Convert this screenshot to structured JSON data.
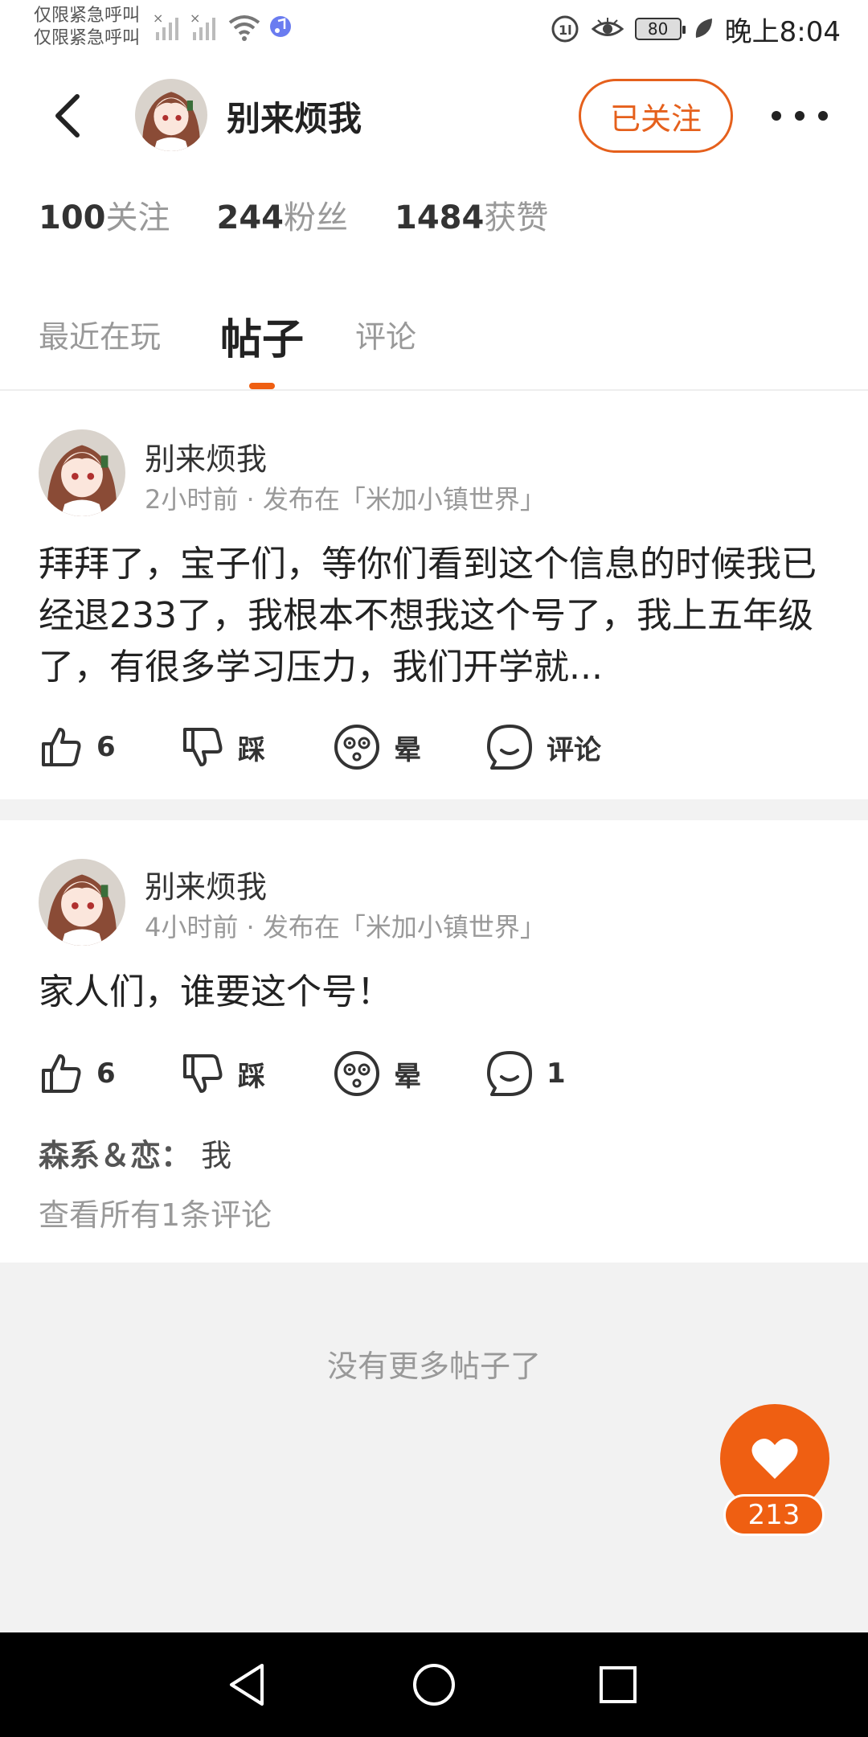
{
  "status_bar": {
    "carrier_line1": "仅限紧急呼叫",
    "carrier_line2": "仅限紧急呼叫",
    "battery": "80",
    "time": "晚上8:04"
  },
  "header": {
    "name": "别来烦我",
    "follow_label": "已关注"
  },
  "stats": [
    {
      "num": "100",
      "label": "关注"
    },
    {
      "num": "244",
      "label": "粉丝"
    },
    {
      "num": "1484",
      "label": "获赞"
    }
  ],
  "tabs": [
    "最近在玩",
    "帖子",
    "评论"
  ],
  "posts": [
    {
      "author": "别来烦我",
      "meta": "2小时前 · 发布在「米加小镇世界」",
      "body": "拜拜了，宝子们，等你们看到这个信息的时候我已经退233了，我根本不想我这个号了，我上五年级了，有很多学习压力，我们开学就...",
      "like": "6",
      "dislike": "踩",
      "dizzy": "晕",
      "comment": "评论"
    },
    {
      "author": "别来烦我",
      "meta": "4小时前 · 发布在「米加小镇世界」",
      "body": "家人们，谁要这个号！",
      "like": "6",
      "dislike": "踩",
      "dizzy": "晕",
      "comment": "1",
      "comment_user": "森系＆恋：",
      "comment_text": "我",
      "view_all": "查看所有1条评论"
    }
  ],
  "footer": {
    "no_more": "没有更多帖子了"
  },
  "fab": {
    "count": "213"
  },
  "colors": {
    "accent": "#ef5f12",
    "follow_border": "#e5601c"
  }
}
